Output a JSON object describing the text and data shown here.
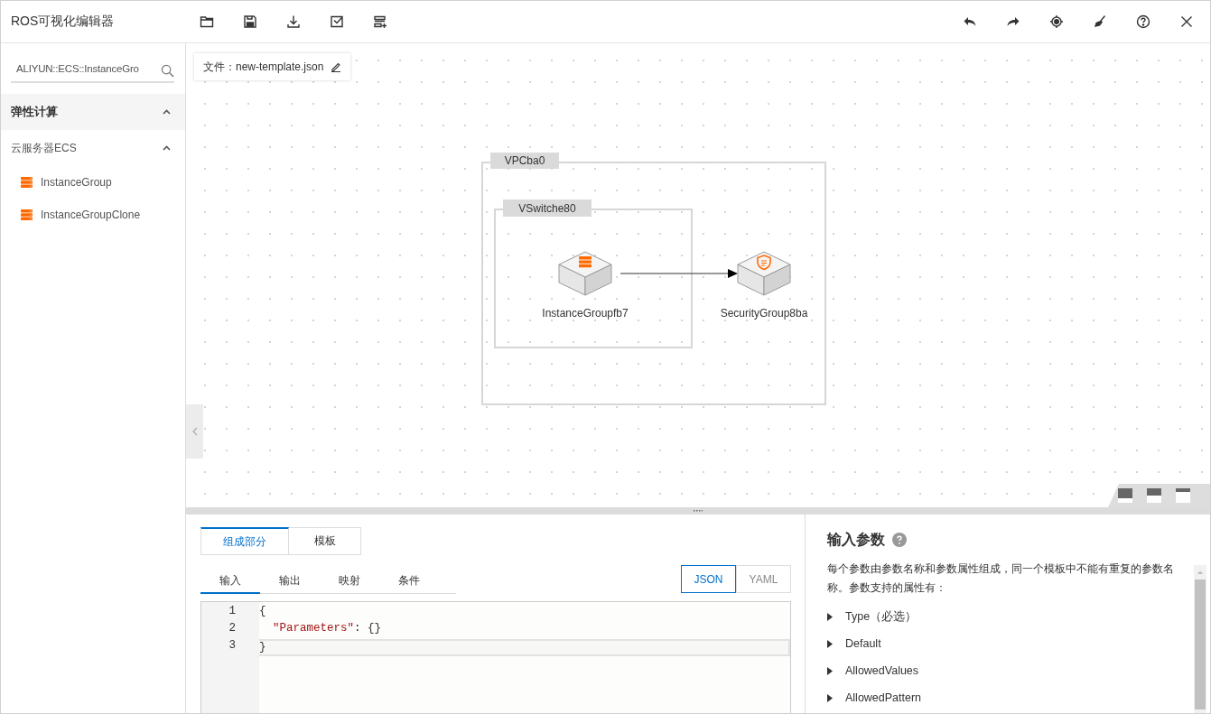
{
  "app": {
    "title": "ROS可视化编辑器"
  },
  "sidebar": {
    "search": {
      "value": "ALIYUN::ECS::InstanceGro"
    },
    "groups": [
      {
        "label": "弹性计算",
        "expanded": true,
        "children": [
          {
            "label": "云服务器ECS",
            "expanded": true,
            "children": [
              {
                "label": "InstanceGroup"
              },
              {
                "label": "InstanceGroupClone"
              }
            ]
          }
        ]
      }
    ]
  },
  "canvas": {
    "file_label": "文件：new-template.json",
    "groups": [
      {
        "label": "VPCba0"
      },
      {
        "label": "VSwitche80"
      }
    ],
    "nodes": [
      {
        "label": "InstanceGroupfb7",
        "kind": "server"
      },
      {
        "label": "SecurityGroup8ba",
        "kind": "shield"
      }
    ]
  },
  "bottom": {
    "tabs": [
      {
        "label": "组成部分",
        "selected": true
      },
      {
        "label": "模板",
        "selected": false
      }
    ],
    "section_tabs": [
      {
        "label": "输入",
        "selected": true
      },
      {
        "label": "输出",
        "selected": false
      },
      {
        "label": "映射",
        "selected": false
      },
      {
        "label": "条件",
        "selected": false
      }
    ],
    "formats": [
      {
        "label": "JSON",
        "selected": true
      },
      {
        "label": "YAML",
        "selected": false
      }
    ],
    "editor": {
      "lines": [
        {
          "number": "1",
          "active": false,
          "tokens": [
            {
              "text": "{",
              "kind": "punct"
            }
          ]
        },
        {
          "number": "2",
          "active": false,
          "tokens": [
            {
              "text": "\"Parameters\"",
              "kind": "key"
            },
            {
              "text": ": {}",
              "kind": "punct"
            }
          ]
        },
        {
          "number": "3",
          "active": true,
          "tokens": [
            {
              "text": "}",
              "kind": "punct"
            }
          ]
        }
      ]
    }
  },
  "help": {
    "title": "输入参数",
    "description": "每个参数由参数名称和参数属性组成，同一个模板中不能有重复的参数名称。参数支持的属性有：",
    "properties": [
      "Type（必选）",
      "Default",
      "AllowedValues",
      "AllowedPattern"
    ]
  }
}
